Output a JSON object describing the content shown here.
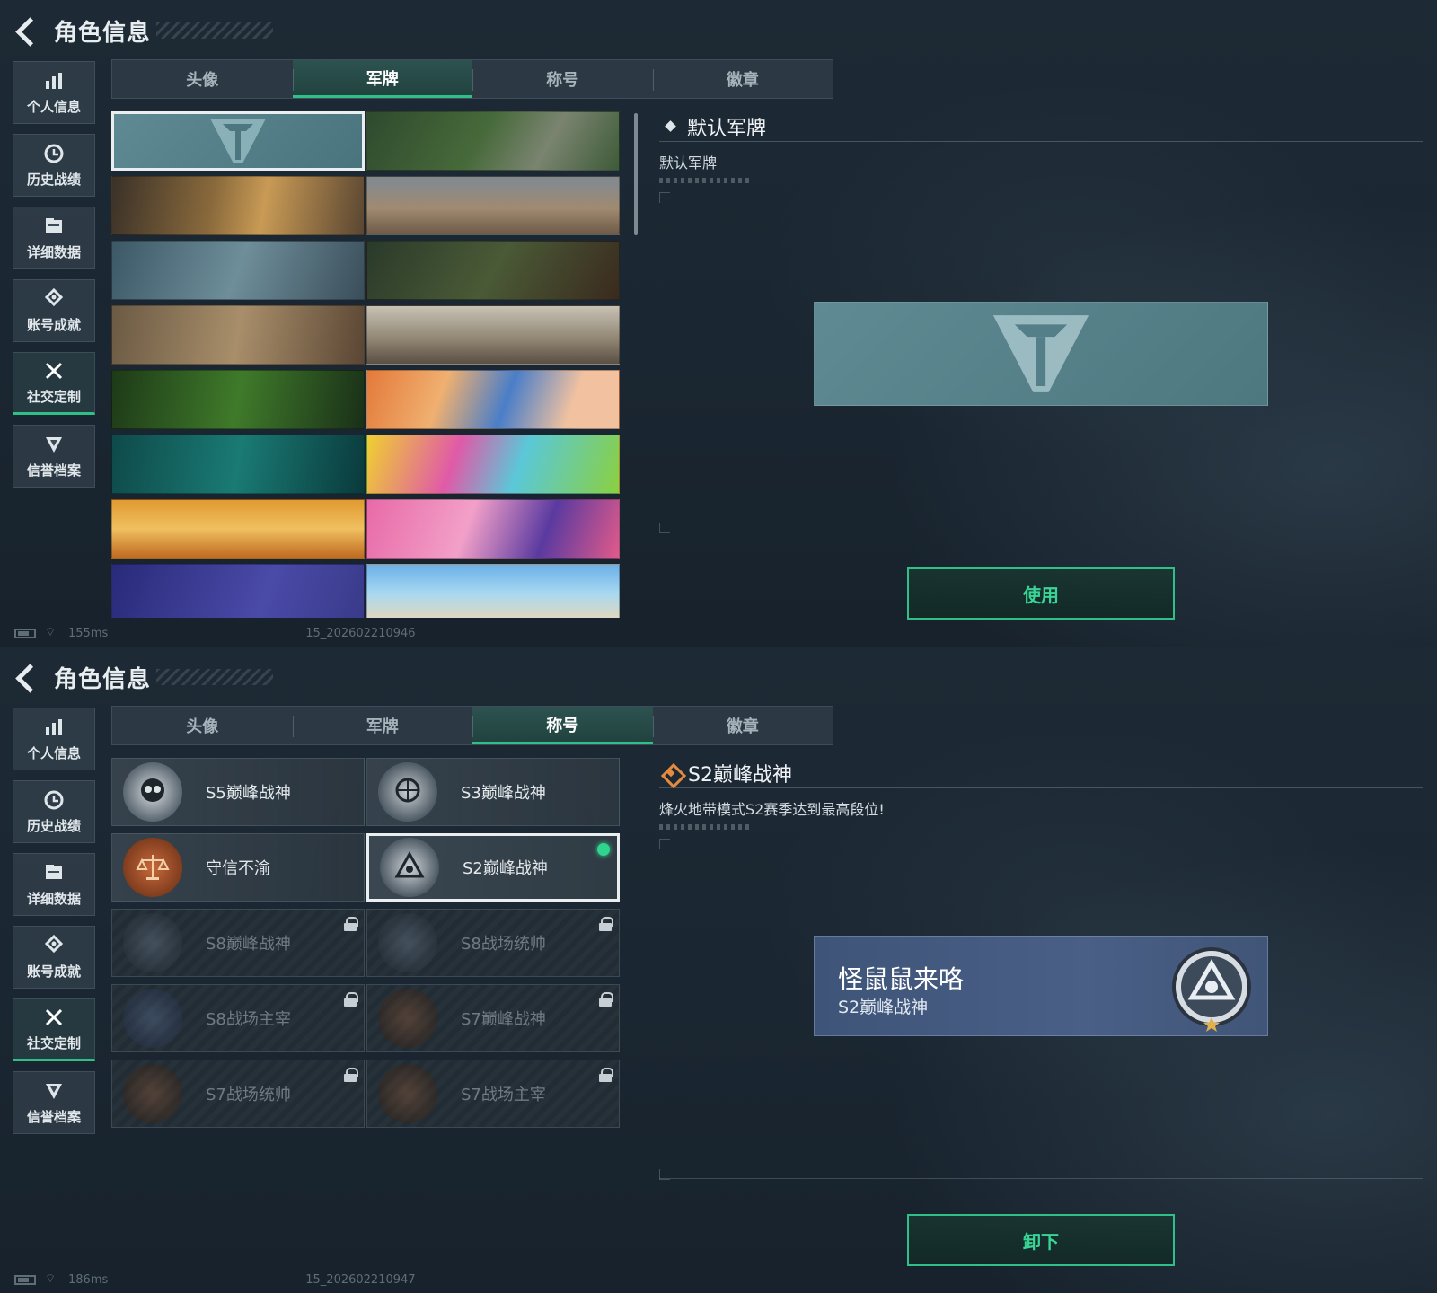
{
  "header": {
    "title": "角色信息"
  },
  "sidebar": {
    "items": [
      {
        "label": "个人信息",
        "icon": "bar-chart-icon"
      },
      {
        "label": "历史战绩",
        "icon": "history-icon"
      },
      {
        "label": "详细数据",
        "icon": "data-folder-icon"
      },
      {
        "label": "账号成就",
        "icon": "achievement-icon"
      },
      {
        "label": "社交定制",
        "icon": "tools-icon",
        "active": true
      },
      {
        "label": "信誉档案",
        "icon": "reputation-icon"
      }
    ]
  },
  "tabs": [
    "头像",
    "军牌",
    "称号",
    "徽章"
  ],
  "screens": [
    {
      "active_tab": "军牌",
      "detail": {
        "title": "默认军牌",
        "description": "默认军牌"
      },
      "action_label": "使用",
      "status": {
        "ping": "155ms",
        "build": "15_202602210946"
      }
    },
    {
      "active_tab": "称号",
      "detail": {
        "title": "S2巅峰战神",
        "description": "烽火地带模式S2赛季达到最高段位!"
      },
      "nameplate": {
        "player_name": "怪鼠鼠来咯",
        "title": "S2巅峰战神"
      },
      "action_label": "卸下",
      "status": {
        "ping": "186ms",
        "build": "15_202602210947"
      }
    }
  ],
  "titles": [
    {
      "label": "S5巅峰战神",
      "locked": false
    },
    {
      "label": "S3巅峰战神",
      "locked": false
    },
    {
      "label": "守信不渝",
      "locked": false
    },
    {
      "label": "S2巅峰战神",
      "locked": false,
      "selected": true,
      "equipped": true
    },
    {
      "label": "S8巅峰战神",
      "locked": true
    },
    {
      "label": "S8战场统帅",
      "locked": true
    },
    {
      "label": "S8战场主宰",
      "locked": true
    },
    {
      "label": "S7巅峰战神",
      "locked": true
    },
    {
      "label": "S7战场统帅",
      "locked": true
    },
    {
      "label": "S7战场主宰",
      "locked": true
    }
  ],
  "colors": {
    "accent": "#2fbf87",
    "accent_text": "#3ad596",
    "orange": "#e58a3e",
    "nameplate": "#4a5f86"
  }
}
